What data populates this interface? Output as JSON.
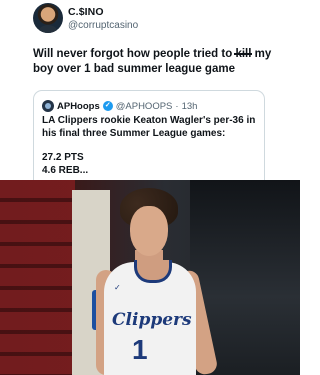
{
  "tweet": {
    "author_name": "C.$INO",
    "author_handle": "@corruptcasino",
    "text_before": "Will never forgot how people tried to ",
    "text_redacted": "kill",
    "text_after": " my boy over 1 bad summer league game"
  },
  "quote": {
    "author_name": "APHoops",
    "verified_mark": "✓",
    "author_handle": "@APHOOPS",
    "separator": "·",
    "time": "13h",
    "body": "LA Clippers rookie Keaton Wagler's per-36 in his final three Summer League games:",
    "stats": [
      "27.2 PTS",
      "4.6 REB..."
    ]
  },
  "photo": {
    "jersey_text": "Clippers",
    "jersey_number": "1",
    "jersey_brand": "✓"
  }
}
